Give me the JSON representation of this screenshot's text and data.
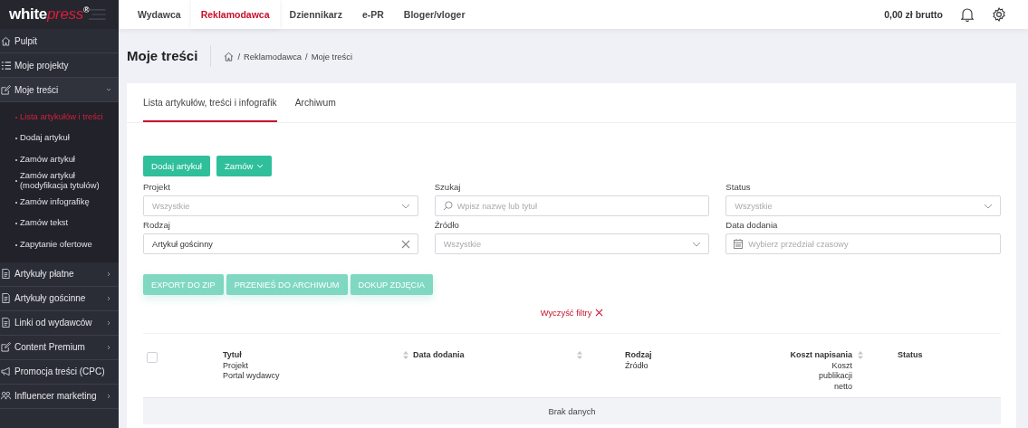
{
  "logo": {
    "name": "white",
    "accent": "press",
    "mark": "®"
  },
  "top_nav": [
    {
      "label": "Wydawca",
      "selected": false
    },
    {
      "label": "Reklamodawca",
      "selected": true
    },
    {
      "label": "Dziennikarz",
      "selected": false
    },
    {
      "label": "e-PR",
      "selected": false
    },
    {
      "label": "Bloger/vloger",
      "selected": false
    }
  ],
  "balance": "0,00 zł brutto",
  "sidebar": {
    "items": [
      {
        "label": "Pulpit",
        "has_arrow": false
      },
      {
        "label": "Moje projekty",
        "has_arrow": false
      },
      {
        "label": "Moje treści",
        "has_arrow": true,
        "expanded": true,
        "children": [
          {
            "label": "Lista artykułów i treści",
            "selected": true
          },
          {
            "label": "Dodaj artykuł",
            "selected": false
          },
          {
            "label": "Zamów artykuł",
            "selected": false
          },
          {
            "label": "Zamów artykuł (modyfikacja tytułów)",
            "selected": false
          },
          {
            "label": "Zamów infografikę",
            "selected": false
          },
          {
            "label": "Zamów tekst",
            "selected": false
          },
          {
            "label": "Zapytanie ofertowe",
            "selected": false
          }
        ]
      },
      {
        "label": "Artykuły płatne",
        "has_arrow": true,
        "expanded": false
      },
      {
        "label": "Artykuły gościnne",
        "has_arrow": true,
        "expanded": false
      },
      {
        "label": "Linki od wydawców",
        "has_arrow": true,
        "expanded": false
      },
      {
        "label": "Content Premium",
        "has_arrow": true,
        "expanded": false
      },
      {
        "label": "Promocja treści (CPC)",
        "has_arrow": false,
        "expanded": false
      },
      {
        "label": "Influencer marketing",
        "has_arrow": true,
        "expanded": false
      }
    ]
  },
  "page_title": "Moje treści",
  "breadcrumb": [
    "Reklamodawca",
    "Moje treści"
  ],
  "breadcrumb_separator": "/",
  "tabs": [
    {
      "label": "Lista artykułów, treści i infografik",
      "selected": true
    },
    {
      "label": "Archiwum",
      "selected": false
    }
  ],
  "primary_buttons": [
    {
      "label": "Dodaj artykuł",
      "kind": "plain"
    },
    {
      "label": "Zamów",
      "kind": "dropdown"
    }
  ],
  "filters": [
    {
      "label": "Projekt",
      "kind": "select",
      "placeholder": "Wszystkie"
    },
    {
      "label": "Szukaj",
      "kind": "search",
      "placeholder": "Wpisz nazwę lub tytuł"
    },
    {
      "label": "Status",
      "kind": "select",
      "placeholder": "Wszystkie"
    },
    {
      "label": "Rodzaj",
      "kind": "clearable",
      "value": "Artykuł gościnny"
    },
    {
      "label": "Źródło",
      "kind": "select",
      "placeholder": "Wszystkie"
    },
    {
      "label": "Data dodania",
      "kind": "date",
      "placeholder": "Wybierz przedział czasowy"
    }
  ],
  "action_buttons": [
    {
      "label": "EXPORT DO ZIP",
      "disabled": true
    },
    {
      "label": "PRZENIEŚ DO ARCHIWUM",
      "disabled": true
    },
    {
      "label": "DOKUP ZDJĘCIA",
      "disabled": true
    }
  ],
  "clear_filters": "Wyczyść filtry",
  "table": {
    "select_all_checked": false,
    "columns": [
      {
        "lines": [
          "Tytuł",
          "Projekt",
          "Portal wydawcy"
        ],
        "sortable": true
      },
      {
        "lines": [
          "Data dodania"
        ],
        "sortable": true
      },
      {
        "lines": [
          "Rodzaj",
          "Źródło"
        ],
        "sortable": false
      },
      {
        "lines": [
          "Koszt napisania",
          "Koszt publikacji netto"
        ],
        "sortable": true
      },
      {
        "lines": [
          "Status"
        ],
        "sortable": false
      }
    ],
    "empty_text": "Brak danych"
  }
}
